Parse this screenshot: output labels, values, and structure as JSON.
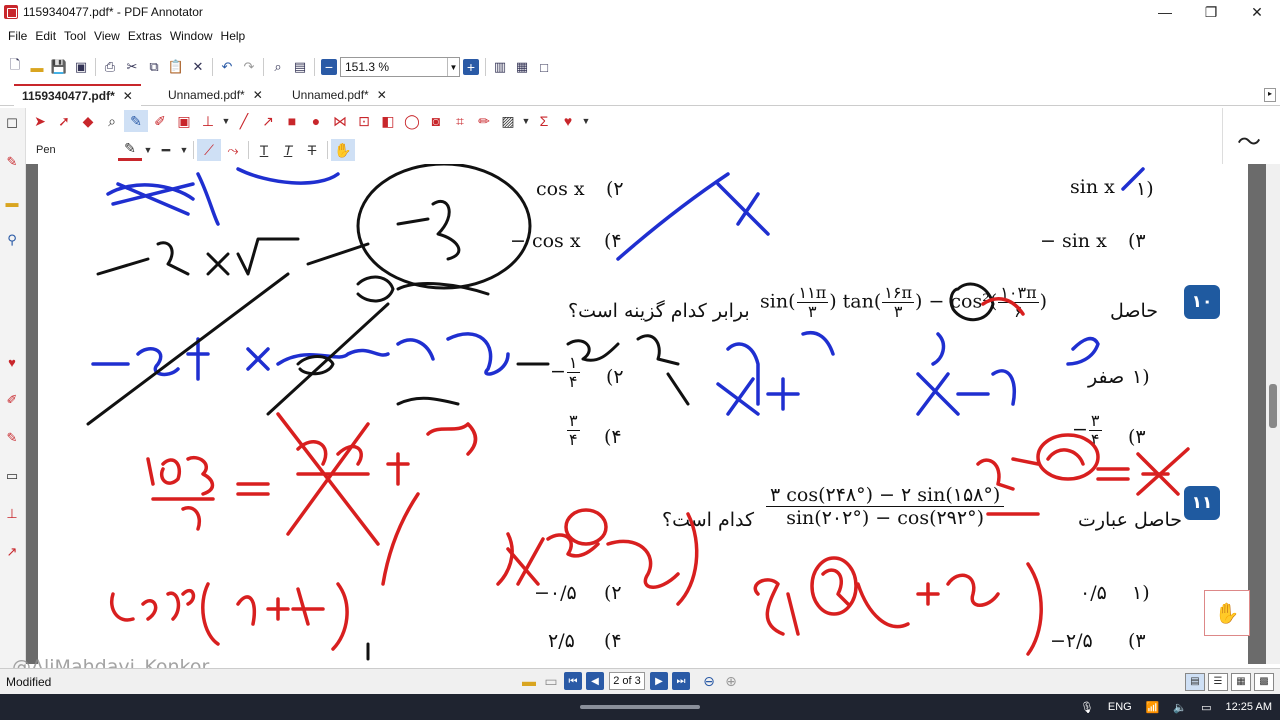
{
  "window": {
    "title": "1159340477.pdf* - PDF Annotator"
  },
  "menu": [
    "File",
    "Edit",
    "Tool",
    "View",
    "Extras",
    "Window",
    "Help"
  ],
  "toolbar": {
    "zoom": "151.3 %"
  },
  "tabs": [
    {
      "label": "1159340477.pdf*",
      "close": "✕"
    },
    {
      "label": "Unnamed.pdf*",
      "close": "✕"
    },
    {
      "label": "Unnamed.pdf*",
      "close": "✕"
    }
  ],
  "annotation_toolbar": {
    "current_tool": "Pen",
    "text_tools": [
      "T",
      "T",
      "T"
    ]
  },
  "document": {
    "top_options": {
      "opt1": "sin x",
      "opt1_num": "۱)",
      "opt2": "cos x",
      "opt2_num": "(۲",
      "opt3": "− sin x",
      "opt3_num": "(۳",
      "opt4": "− cos x",
      "opt4_num": "(۴"
    },
    "q10": {
      "number": "۱۰",
      "lead": "حاصل",
      "tail": "برابر کدام گزینه است؟",
      "expr_sin": "sin",
      "f1_num": "۱۱π",
      "f1_den": "۳",
      "expr_tan": "tan",
      "f2_num": "۱۶π",
      "f2_den": "۳",
      "expr_cos": "− cos²",
      "f3_num": "۱۰۳π",
      "f3_den": "۶",
      "opt1": "صفر",
      "opt1_num": "۱)",
      "opt2_num": "(۲",
      "opt2_sign": "−",
      "opt2_f_num": "۱",
      "opt2_f_den": "۴",
      "opt3_num": "(۳",
      "opt3_sign": "−",
      "opt3_f_num": "۳",
      "opt3_f_den": "۴",
      "opt4_num": "(۴",
      "opt4_f_num": "۳",
      "opt4_f_den": "۴"
    },
    "q11": {
      "number": "۱۱",
      "lead": "حاصل عبارت",
      "tail": "کدام است؟",
      "numerator": "۳ cos(۲۴۸°) − ۲ sin(۱۵۸°)",
      "denominator": "sin(۲۰۲°) − cos(۲۹۲°)",
      "opt1": "۰/۵",
      "opt1_num": "۱)",
      "opt2": "−۰/۵",
      "opt2_num": "(۲",
      "opt3": "−۲/۵",
      "opt3_num": "(۳",
      "opt4": "۲/۵",
      "opt4_num": "(۴"
    }
  },
  "watermark": "@AliMahdavi_Konkor",
  "status": {
    "left_text": "Modified",
    "page_indicator": "2 of 3"
  },
  "taskbar": {
    "lang": "ENG",
    "time": "12:25 AM"
  },
  "colors": {
    "accent": "#c8262b",
    "brand_blue": "#1f5aa0",
    "ink_blue": "#1f2fd0",
    "ink_red": "#d81f1f"
  }
}
